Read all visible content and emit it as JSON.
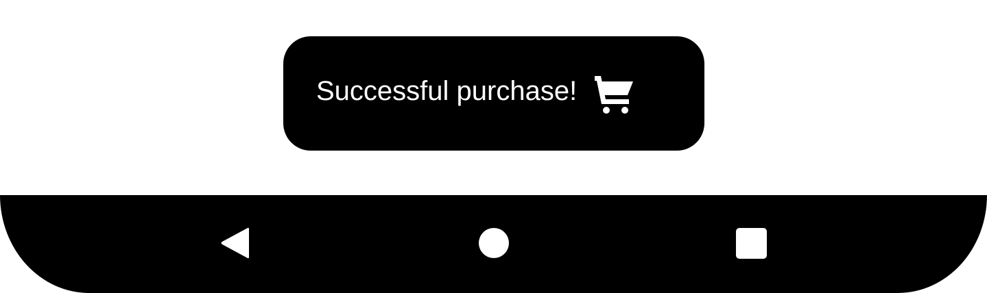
{
  "toast": {
    "message": "Successful purchase!",
    "icon": "shopping-cart-icon",
    "background": "#000000",
    "text_color": "#ffffff"
  },
  "navigation_bar": {
    "background": "#000000",
    "buttons": [
      {
        "name": "back",
        "icon": "back-triangle-icon"
      },
      {
        "name": "home",
        "icon": "home-circle-icon"
      },
      {
        "name": "recents",
        "icon": "recents-square-icon"
      }
    ]
  },
  "page": {
    "background": "#ffffff"
  }
}
